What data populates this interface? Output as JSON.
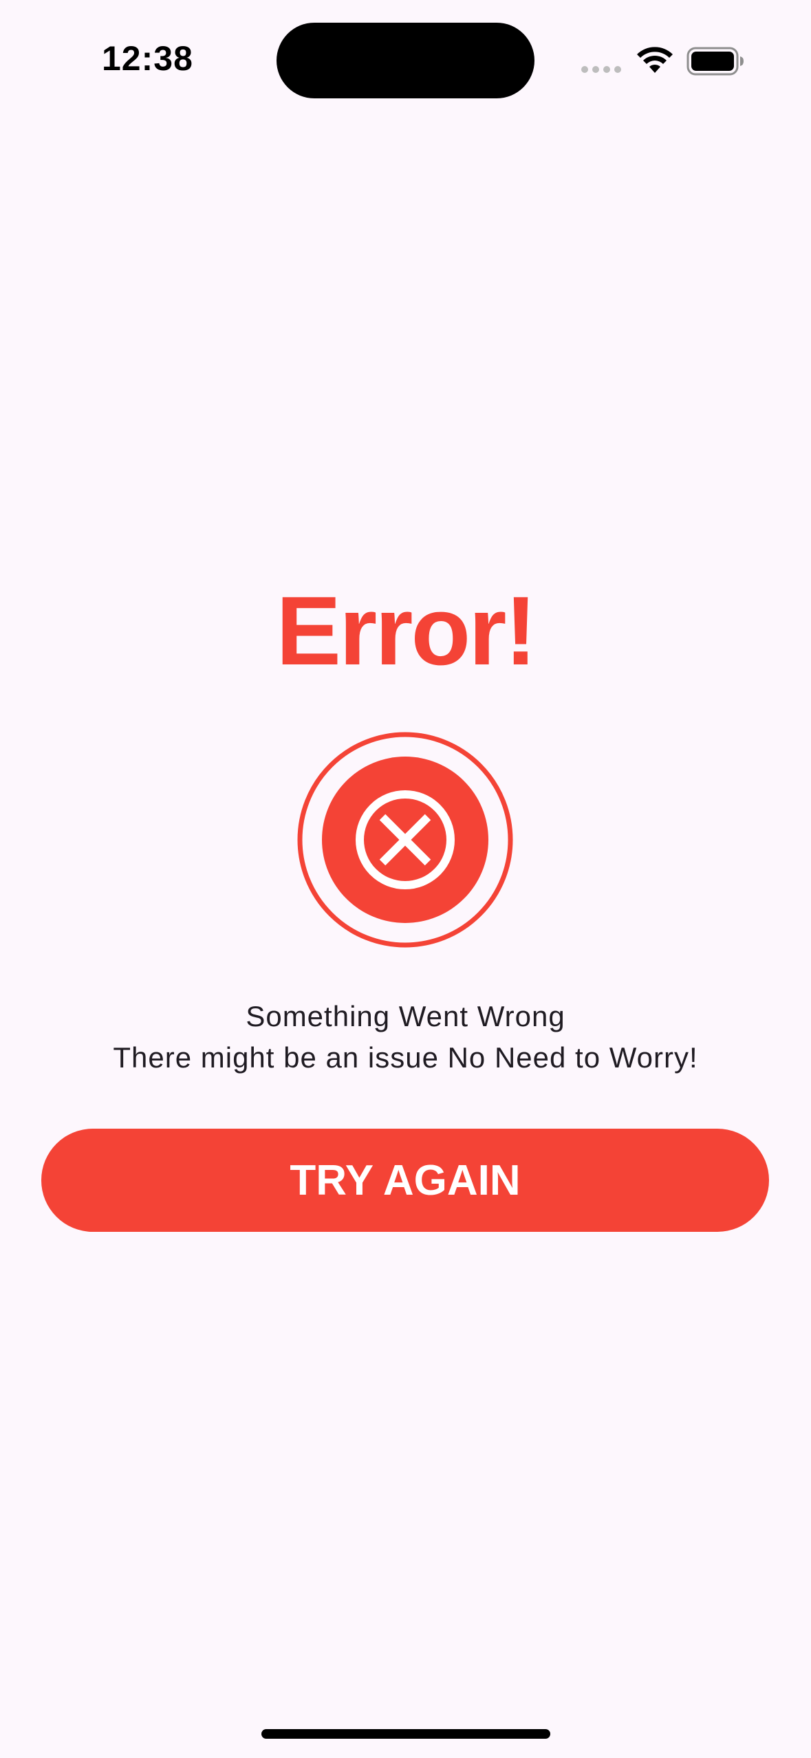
{
  "status_bar": {
    "time": "12:38"
  },
  "main": {
    "title": "Error!",
    "message_line1": "Something Went Wrong",
    "message_line2": "There might be an issue No Need to Worry!",
    "button_label": "TRY AGAIN"
  },
  "icons": {
    "error": "x-circle-icon",
    "wifi": "wifi-icon",
    "battery": "battery-icon",
    "signal": "signal-dots-icon"
  },
  "colors": {
    "accent": "#F44336",
    "background": "#FDF7FD",
    "text": "#1F1B22"
  }
}
